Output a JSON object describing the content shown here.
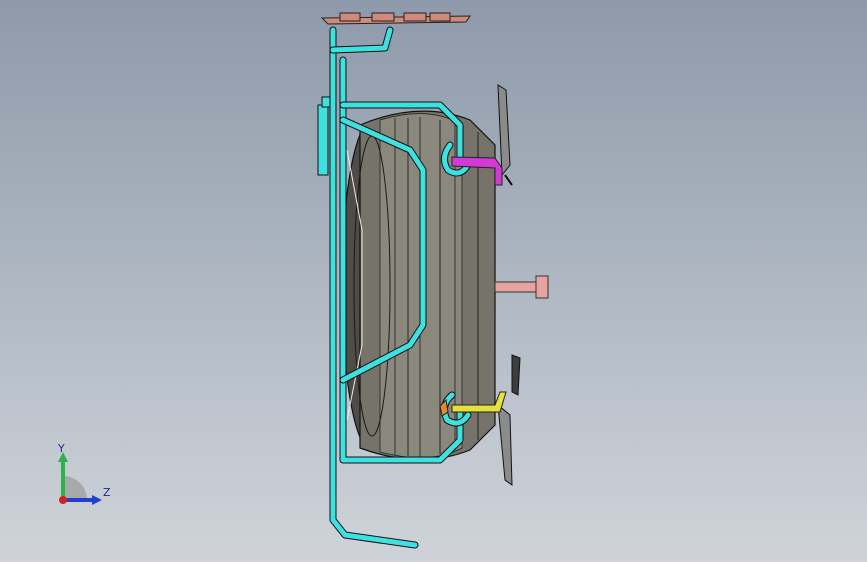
{
  "viewport": {
    "background_top": "#8e9aaa",
    "background_bottom": "#cfd3d9"
  },
  "model": {
    "tube_color": "#3fe0e0",
    "rim_color": "#6f6d63",
    "bolt_color": "#e7a3a0",
    "clamp_top_color": "#d23ad6",
    "clamp_bottom_color": "#e4e23a",
    "bracket_color": "#cf8a7a"
  },
  "triad": {
    "y_label": "Y",
    "z_label": "Z",
    "y_color": "#2bb34a",
    "z_color": "#1f3fd1",
    "x_color": "#d22020"
  }
}
